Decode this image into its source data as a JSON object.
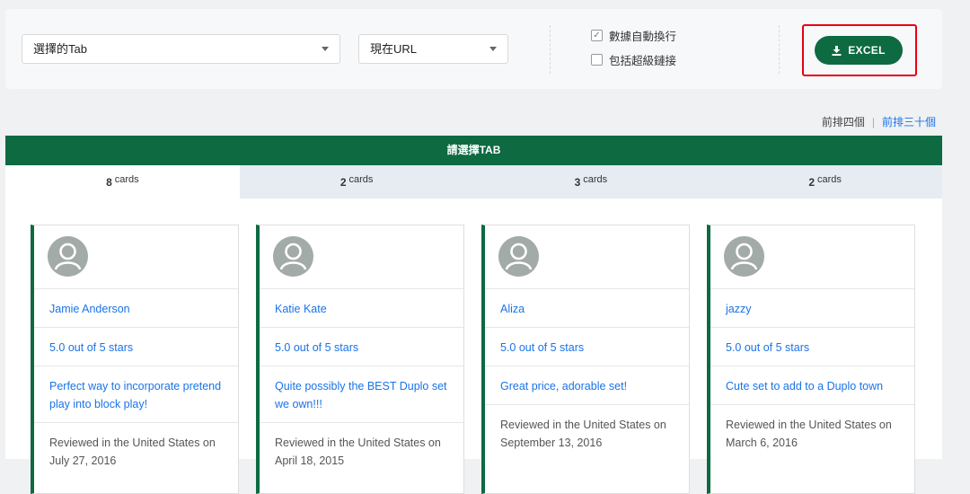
{
  "toolbar": {
    "tab_select": "選擇的Tab",
    "url_select": "現在URL",
    "checkbox_wrap": {
      "label": "數據自動換行",
      "checked": true
    },
    "checkbox_links": {
      "label": "包括超級鏈接",
      "checked": false
    },
    "excel_label": "EXCEL",
    "excel_icon": "download-icon",
    "accent_color": "#0d6a41",
    "highlight_color": "#e60012"
  },
  "count_links": {
    "first": "前排四個",
    "separator": "|",
    "second": "前排三十個"
  },
  "band_title": "請選擇TAB",
  "tabs": [
    {
      "count": "8",
      "unit": "cards"
    },
    {
      "count": "2",
      "unit": "cards"
    },
    {
      "count": "3",
      "unit": "cards"
    },
    {
      "count": "2",
      "unit": "cards"
    }
  ],
  "cards": [
    {
      "name": "Jamie Anderson",
      "rating": "5.0 out of 5 stars",
      "title": "Perfect way to incorporate pretend play into block play!",
      "meta": "Reviewed in the United States on July 27, 2016"
    },
    {
      "name": "Katie Kate",
      "rating": "5.0 out of 5 stars",
      "title": "Quite possibly the BEST Duplo set we own!!!",
      "meta": "Reviewed in the United States on April 18, 2015"
    },
    {
      "name": "Aliza",
      "rating": "5.0 out of 5 stars",
      "title": "Great price, adorable set!",
      "meta": "Reviewed in the United States on September 13, 2016"
    },
    {
      "name": "jazzy",
      "rating": "5.0 out of 5 stars",
      "title": "Cute set to add to a Duplo town",
      "meta": "Reviewed in the United States on March 6, 2016"
    }
  ]
}
